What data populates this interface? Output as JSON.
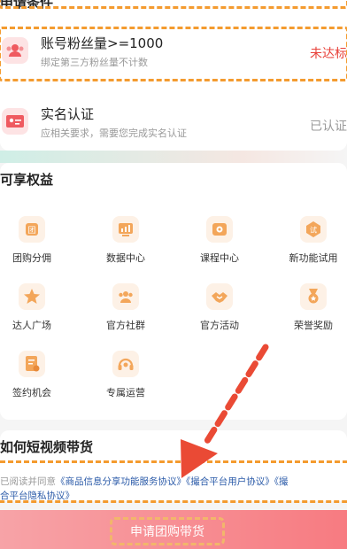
{
  "requirements": {
    "title": "申请条件",
    "items": [
      {
        "label": "账号粉丝量>=1000",
        "sub": "绑定第三方粉丝量不计数",
        "status": "未达标"
      },
      {
        "label": "实名认证",
        "sub": "应相关要求，需要您完成实名认证",
        "status": "已认证"
      }
    ]
  },
  "benefits": {
    "title": "可享权益",
    "items": [
      {
        "label": "团购分佣",
        "icon": "group-buy-icon"
      },
      {
        "label": "数据中心",
        "icon": "data-center-icon"
      },
      {
        "label": "课程中心",
        "icon": "course-center-icon"
      },
      {
        "label": "新功能试用",
        "icon": "trial-icon"
      },
      {
        "label": "达人广场",
        "icon": "star-icon"
      },
      {
        "label": "官方社群",
        "icon": "community-icon"
      },
      {
        "label": "官方活动",
        "icon": "handshake-icon"
      },
      {
        "label": "荣誉奖励",
        "icon": "medal-icon"
      },
      {
        "label": "签约机会",
        "icon": "contract-icon"
      },
      {
        "label": "专属运营",
        "icon": "headset-icon"
      }
    ]
  },
  "how": {
    "title": "如何短视频带货"
  },
  "agreement": {
    "prefix": "已阅读并同意",
    "link1": "《商品信息分享功能服务协议》",
    "link2": "《撮合平台用户协议》",
    "link3": "《撮",
    "link3b": "合平台隐私协议》"
  },
  "apply_button": "申请团购带货",
  "colors": {
    "accent_orange": "#f49b2f",
    "fail_red": "#e8413a",
    "ok_gray": "#999999",
    "link_blue": "#2a5aa8",
    "button_pink": "#f77b81",
    "arrow_red": "#ea4a35"
  }
}
